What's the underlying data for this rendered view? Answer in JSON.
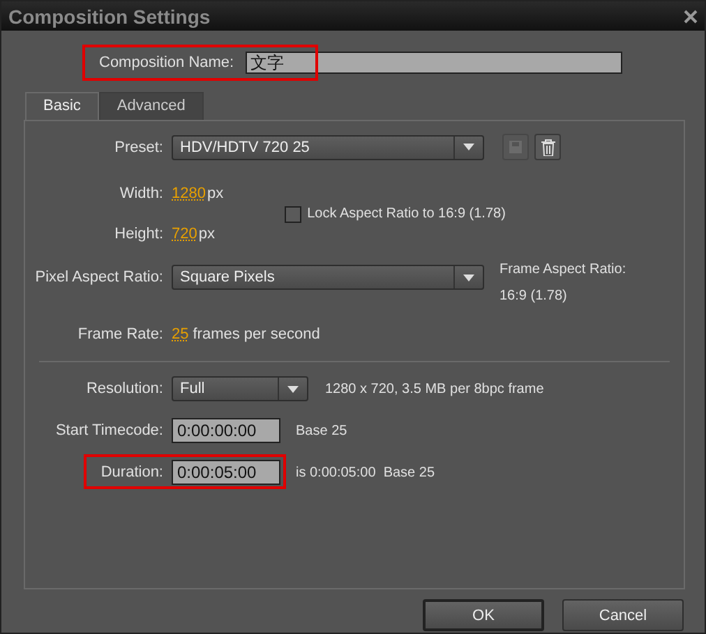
{
  "window": {
    "title": "Composition Settings"
  },
  "composition_name": {
    "label": "Composition Name:",
    "value": "文字",
    "highlighted": true
  },
  "tabs": [
    {
      "label": "Basic",
      "selected": true
    },
    {
      "label": "Advanced",
      "selected": false
    }
  ],
  "preset": {
    "label": "Preset:",
    "value": "HDV/HDTV 720 25",
    "save_disabled": true
  },
  "width": {
    "label": "Width:",
    "value": "1280",
    "unit": "px"
  },
  "height": {
    "label": "Height:",
    "value": "720",
    "unit": "px"
  },
  "lock_aspect": {
    "label": "Lock Aspect Ratio to 16:9 (1.78)",
    "checked": false
  },
  "pixel_aspect_ratio": {
    "label": "Pixel Aspect Ratio:",
    "value": "Square Pixels"
  },
  "frame_aspect_ratio": {
    "label": "Frame Aspect Ratio:",
    "value": "16:9 (1.78)"
  },
  "frame_rate": {
    "label": "Frame Rate:",
    "value": "25",
    "unit": "frames per second"
  },
  "resolution": {
    "label": "Resolution:",
    "value": "Full",
    "info": "1280 x 720, 3.5 MB per 8bpc frame"
  },
  "start_timecode": {
    "label": "Start Timecode:",
    "value": "0:00:00:00",
    "note": "Base 25",
    "highlighted": false
  },
  "duration": {
    "label": "Duration:",
    "value": "0:00:05:00",
    "note": "is 0:00:05:00  Base 25",
    "highlighted": true
  },
  "buttons": [
    {
      "label": "OK",
      "default": true
    },
    {
      "label": "Cancel",
      "default": false
    }
  ]
}
